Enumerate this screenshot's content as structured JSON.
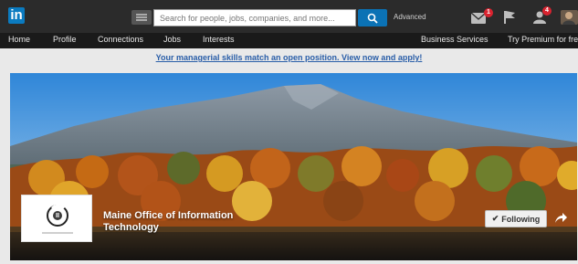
{
  "header": {
    "logo_text": "in",
    "search_placeholder": "Search for people, jobs, companies, and more...",
    "advanced_label": "Advanced",
    "messages_badge": "1",
    "notifications_badge": "4"
  },
  "nav": {
    "items": [
      "Home",
      "Profile",
      "Connections",
      "Jobs",
      "Interests"
    ],
    "business_services": "Business Services",
    "try_premium": "Try Premium for free"
  },
  "banner": {
    "text": "Your managerial skills match an open position. View now and apply!"
  },
  "company": {
    "name": "Maine Office of Information Technology",
    "follow_label": "Following"
  },
  "colors": {
    "topbar": "#2b2b2b",
    "navbar": "#1a1a1a",
    "accent": "#0b72b5",
    "banner_link": "#2a5ea8",
    "badge": "#d9232f"
  },
  "icons": [
    "search-icon",
    "messages-icon",
    "flag-icon",
    "add-connection-icon",
    "avatar",
    "check-icon",
    "share-icon"
  ]
}
